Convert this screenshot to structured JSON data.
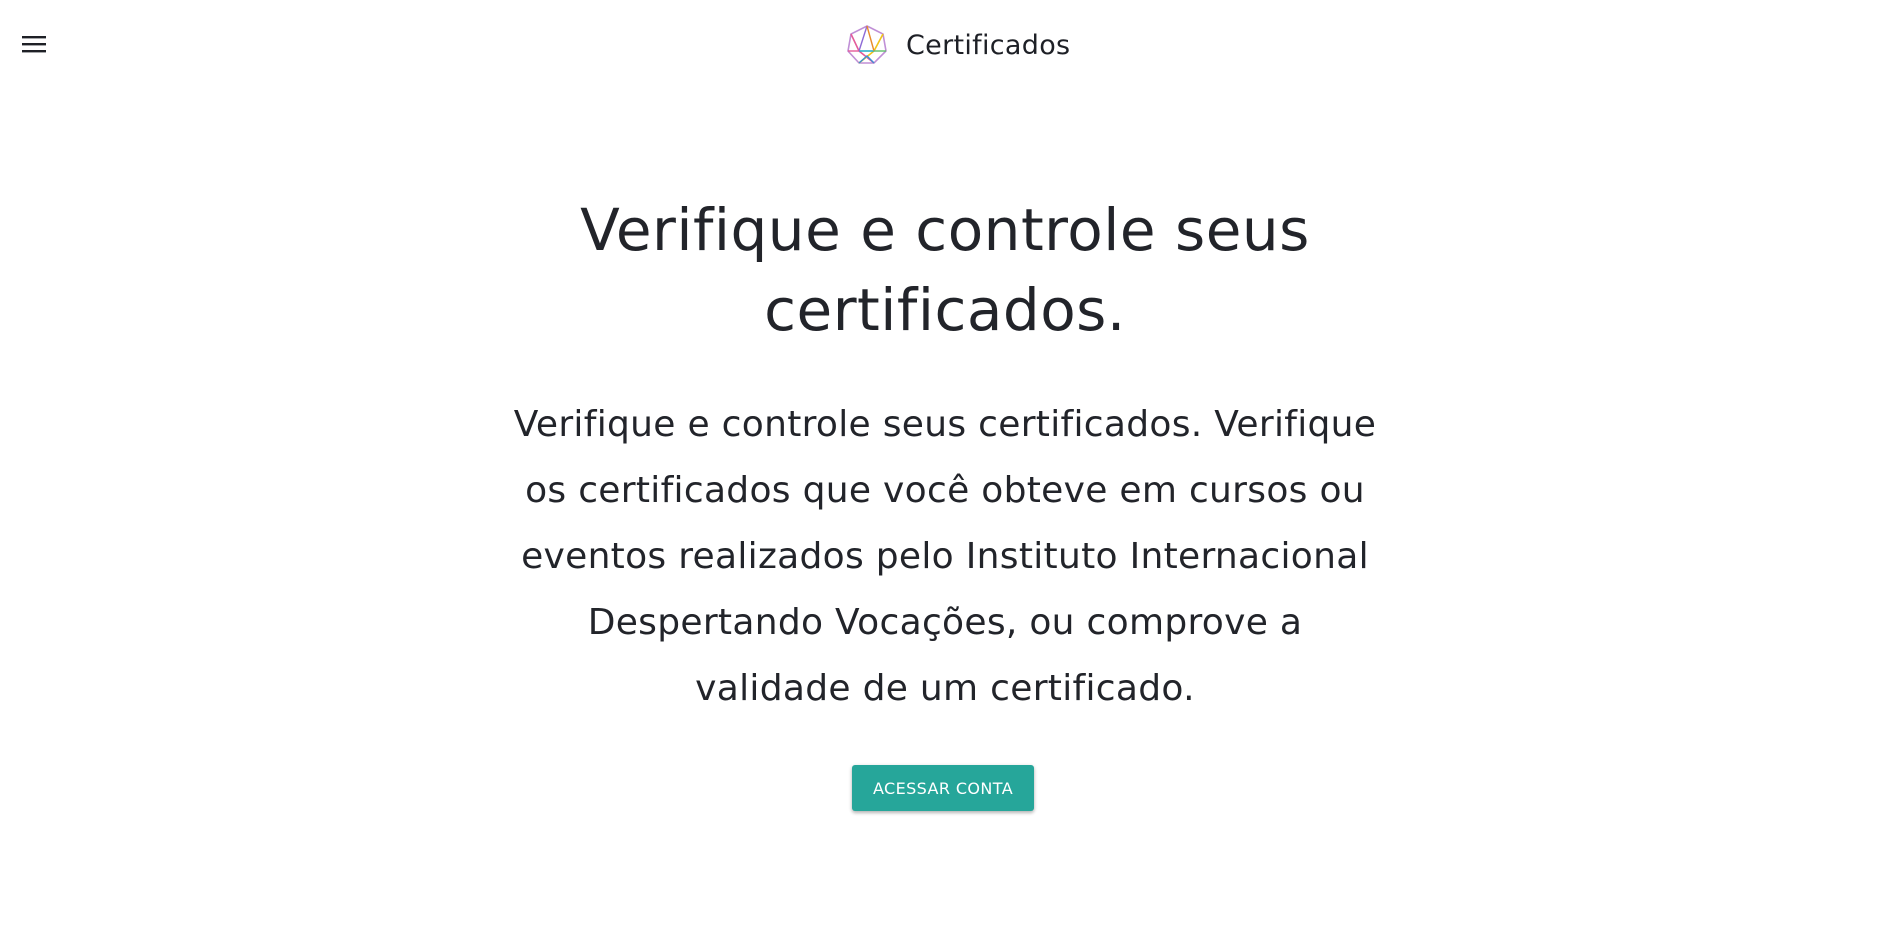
{
  "header": {
    "menu_icon": "hamburger-menu-icon",
    "logo_icon": "geometric-polyhedron-logo-icon",
    "title": "Certificados"
  },
  "hero": {
    "title": "Verifique e controle seus certificados.",
    "description": "Verifique e controle seus certificados. Verifique os certificados que você obteve em cursos ou eventos realizados pelo Instituto Internacional Despertando Vocações, ou comprove a validade de um certificado.",
    "cta_label": "ACESSAR CONTA"
  },
  "colors": {
    "accent": "#26a69a",
    "text": "#22242a",
    "background": "#ffffff"
  }
}
